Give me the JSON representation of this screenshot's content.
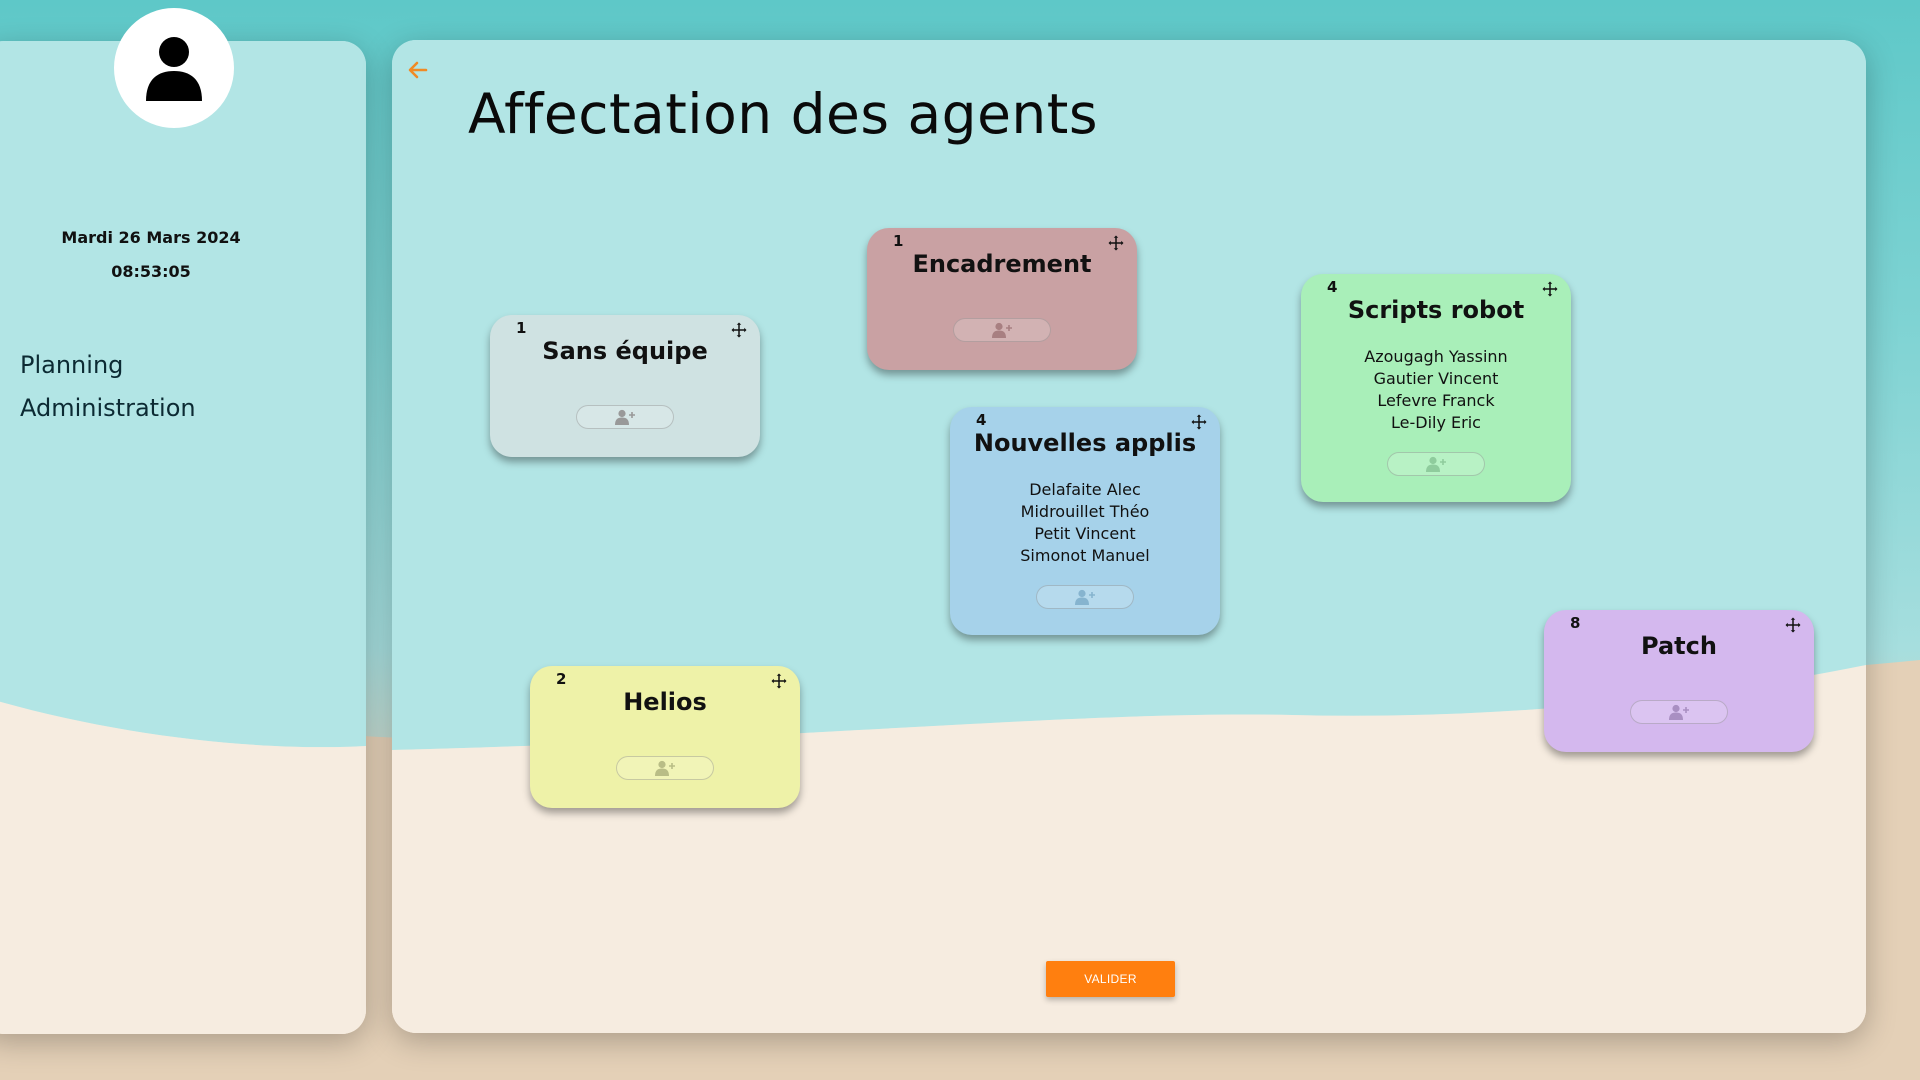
{
  "sidebar": {
    "date": "Mardi 26 Mars 2024",
    "time": "08:53:05",
    "nav": [
      {
        "label": "Planning"
      },
      {
        "label": "Administration"
      }
    ]
  },
  "main": {
    "title": "Affectation des agents",
    "validate_label": "VALIDER"
  },
  "teams": [
    {
      "name": "Sans équipe",
      "count": "1",
      "color": "#cfe2e2",
      "members": []
    },
    {
      "name": "Encadrement",
      "count": "1",
      "color": "#c9a1a3",
      "members": []
    },
    {
      "name": "Scripts robot",
      "count": "4",
      "color": "#a9efb9",
      "members": [
        "Azougagh Yassinn",
        "Gautier Vincent",
        "Lefevre Franck",
        "Le-Dily Eric"
      ]
    },
    {
      "name": "Nouvelles applis",
      "count": "4",
      "color": "#a6d2ea",
      "members": [
        "Delafaite Alec",
        "Midrouillet Théo",
        "Petit Vincent",
        "Simonot Manuel"
      ]
    },
    {
      "name": "Helios",
      "count": "2",
      "color": "#eef2a8",
      "members": []
    },
    {
      "name": "Patch",
      "count": "8",
      "color": "#d4b8ee",
      "members": []
    }
  ],
  "icons": {
    "back": "arrow-left-icon",
    "move": "move-icon",
    "add_agent": "user-plus-icon",
    "avatar": "user-icon"
  },
  "colors": {
    "accent": "#ff7f0f",
    "sea": "#b2e5e5",
    "sand": "#f6ece0"
  }
}
